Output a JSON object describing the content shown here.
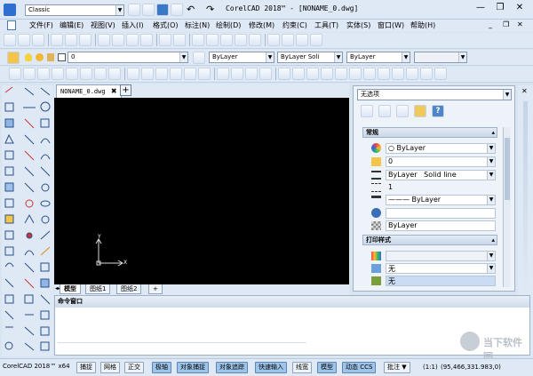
{
  "title_bar": {
    "workspace": "Classic",
    "undo": "↶",
    "redo": "↷",
    "title": "CorelCAD 2018™ - [NONAME_0.dwg]",
    "minimize": "—",
    "restore": "❐",
    "close": "✕"
  },
  "menu": [
    "文件(F)",
    "编辑(E)",
    "视图(V)",
    "插入(I)",
    "格式(O)",
    "标注(N)",
    "绘制(D)",
    "修改(M)",
    "约束(C)",
    "工具(T)",
    "实体(S)",
    "窗口(W)",
    "帮助(H)"
  ],
  "layer_toolbar": {
    "layer_value": "0"
  },
  "props_toolbar": {
    "color": "ByLayer",
    "linetype": "ByLayer",
    "linetype_solid": "Soli",
    "lineweight": "ByLayer"
  },
  "doc_tab": {
    "name": "NONAME_0.dwg",
    "close": "✖",
    "new": "+"
  },
  "layout_tabs": [
    "模型",
    "图纸1",
    "图纸2",
    "+"
  ],
  "ucs": {
    "x": "X",
    "y": "Y"
  },
  "properties": {
    "selection": "无选项",
    "section_general": "常规",
    "section_print": "打印样式",
    "collapse": "▴",
    "help_icon": "?",
    "rows": {
      "color": "ByLayer",
      "layer": "0",
      "linetype_by": "ByLayer",
      "linetype_solid": "Solid line",
      "scale": "1",
      "lineweight": "——— ByLayer",
      "transparency": "",
      "material": "ByLayer",
      "plot_style": "",
      "plot_none1": "无",
      "plot_none2": "无"
    }
  },
  "command_window": {
    "title": "命令窗口"
  },
  "status": {
    "app": "CorelCAD 2018™ x64",
    "buttons": [
      {
        "label": "捕捉",
        "on": false
      },
      {
        "label": "网格",
        "on": false
      },
      {
        "label": "正交",
        "on": false
      },
      {
        "label": "极轴",
        "on": true
      },
      {
        "label": "对象捕捉",
        "on": true
      },
      {
        "label": "对象追踪",
        "on": true
      },
      {
        "label": "快速输入",
        "on": true
      },
      {
        "label": "线宽",
        "on": false
      },
      {
        "label": "模型",
        "on": true
      },
      {
        "label": "动态 CCS",
        "on": true
      },
      {
        "label": "批注",
        "on": false
      }
    ],
    "scale": "(1:1)",
    "coords": "(95,466,331.983,0)"
  },
  "watermark": "当下软件园"
}
